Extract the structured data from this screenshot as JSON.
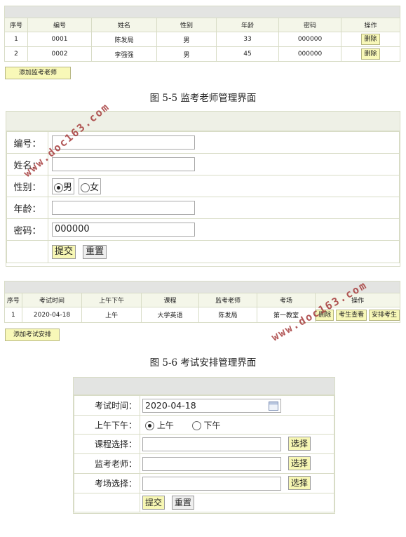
{
  "teacher_table": {
    "headers": [
      "序号",
      "编号",
      "姓名",
      "性别",
      "年龄",
      "密码",
      "操作"
    ],
    "rows": [
      {
        "seq": "1",
        "id": "0001",
        "name": "陈发局",
        "gender": "男",
        "age": "33",
        "password": "000000",
        "action": "删除"
      },
      {
        "seq": "2",
        "id": "0002",
        "name": "李强强",
        "gender": "男",
        "age": "45",
        "password": "000000",
        "action": "删除"
      }
    ],
    "add_button": "添加监考老师"
  },
  "caption1": "图 5-5 监考老师管理界面",
  "teacher_form": {
    "id_label": "编号：",
    "name_label": "姓名：",
    "gender_label": "性别：",
    "male": "男",
    "female": "女",
    "age_label": "年龄：",
    "password_label": "密码：",
    "password_value": "000000",
    "submit": "提交",
    "reset": "重置"
  },
  "exam_table": {
    "headers": [
      "序号",
      "考试时间",
      "上午下午",
      "课程",
      "监考老师",
      "考场",
      "操作"
    ],
    "rows": [
      {
        "seq": "1",
        "date": "2020-04-18",
        "period": "上午",
        "course": "大学英语",
        "teacher": "陈发局",
        "room": "第一教室",
        "btn_delete": "删除",
        "btn_view": "考生查看",
        "btn_arrange": "安排考生"
      }
    ],
    "add_button": "添加考试安排"
  },
  "caption2": "图 5-6 考试安排管理界面",
  "exam_form": {
    "time_label": "考试时间：",
    "time_value": "2020-04-18",
    "period_label": "上午下午：",
    "am": "上午",
    "pm": "下午",
    "course_label": "课程选择：",
    "teacher_label": "监考老师：",
    "room_label": "考场选择：",
    "select_btn": "选择",
    "submit": "提交",
    "reset": "重置"
  },
  "watermark": "www.doc163.com",
  "icons": {
    "calendar": "calendar-icon"
  }
}
